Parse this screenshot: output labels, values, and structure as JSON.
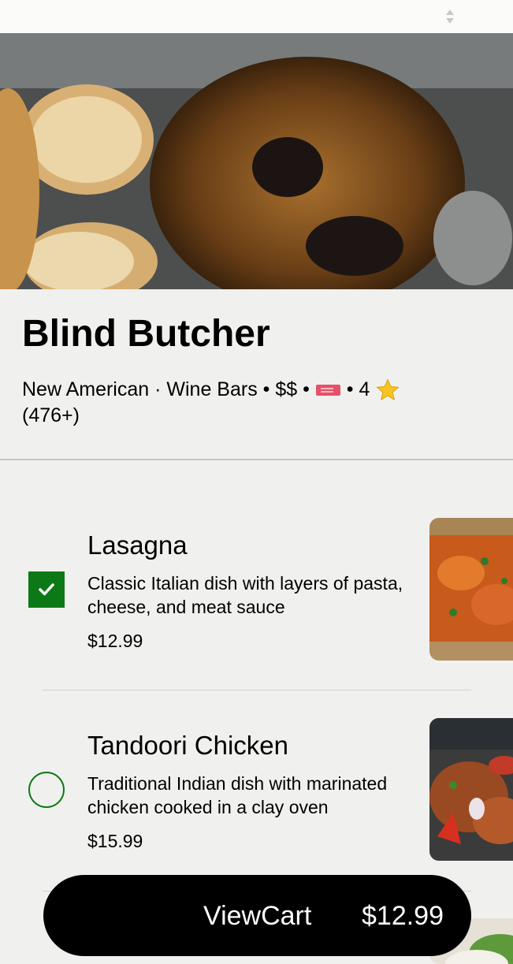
{
  "restaurant": {
    "name": "Blind Butcher",
    "categories": "New American · Wine Bars",
    "price": "$$",
    "rating": "4",
    "reviews": "(476+)"
  },
  "menu": [
    {
      "name": "Lasagna",
      "description": "Classic Italian dish with layers of pasta, cheese, and meat sauce",
      "price": "$12.99",
      "selected": true
    },
    {
      "name": "Tandoori Chicken",
      "description": "Traditional Indian dish with marinated chicken cooked in a clay oven",
      "price": "$15.99",
      "selected": false
    }
  ],
  "cart": {
    "label": "ViewCart",
    "total": "$12.99"
  },
  "icons": {
    "sort": "sort-arrows-icon",
    "ticket": "ticket-icon",
    "star": "star-icon",
    "check": "check-icon"
  },
  "colors": {
    "accent": "#0b7a16",
    "background": "#f0f1ef",
    "ticket": "#e7506a",
    "star": "#f6c525"
  }
}
